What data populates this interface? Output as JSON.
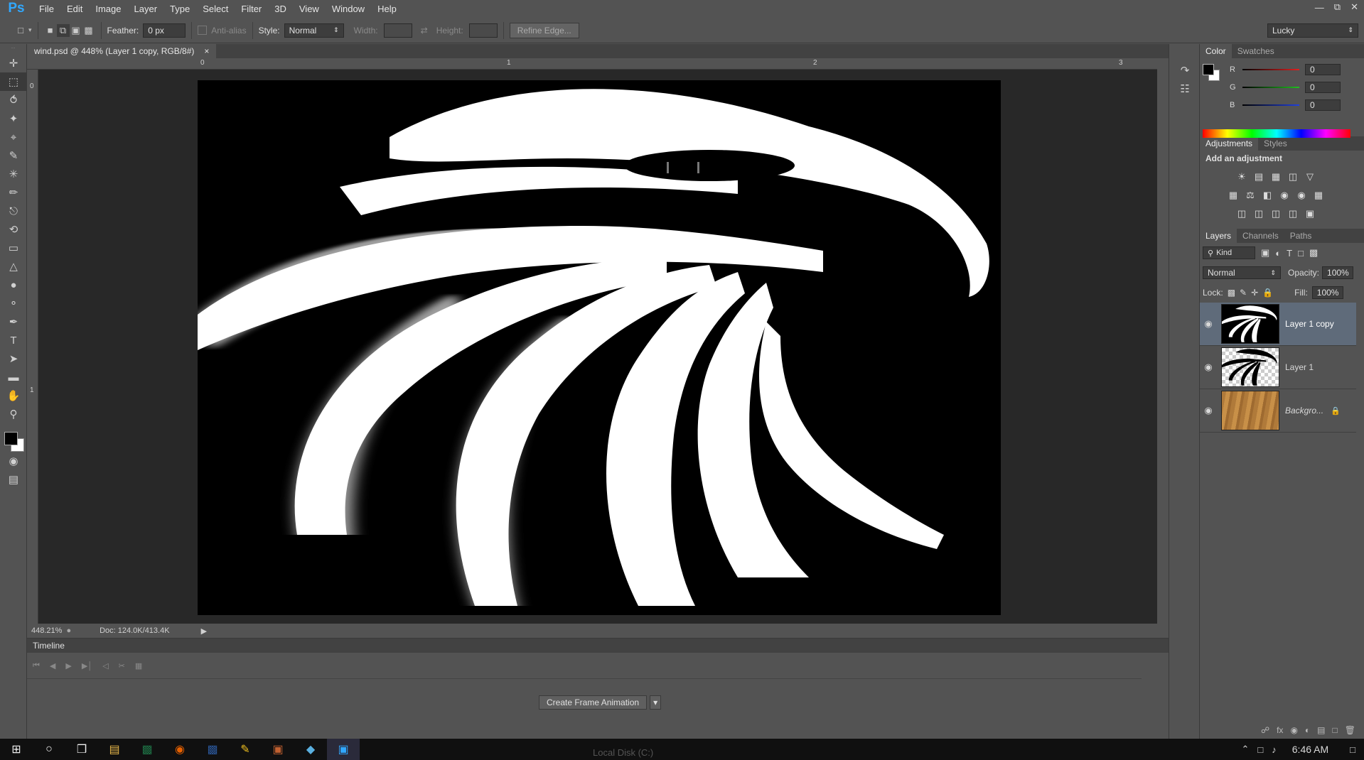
{
  "app": {
    "logo": "Ps"
  },
  "menu": [
    "File",
    "Edit",
    "Image",
    "Layer",
    "Type",
    "Select",
    "Filter",
    "3D",
    "View",
    "Window",
    "Help"
  ],
  "options": {
    "feather_label": "Feather:",
    "feather_value": "0 px",
    "antialias_label": "Anti-alias",
    "style_label": "Style:",
    "style_value": "Normal",
    "width_label": "Width:",
    "height_label": "Height:",
    "refine_edge": "Refine Edge...",
    "workspace": "Lucky"
  },
  "document": {
    "tab_title": "wind.psd @ 448% (Layer 1 copy, RGB/8#)",
    "close": "×",
    "ruler_h": [
      "0",
      "1",
      "2",
      "3"
    ],
    "ruler_v": [
      "0",
      "1"
    ]
  },
  "status": {
    "zoom": "448.21%",
    "doc": "Doc: 124.0K/413.4K"
  },
  "timeline": {
    "title": "Timeline",
    "create_button": "Create Frame Animation"
  },
  "color_panel": {
    "tabs": [
      "Color",
      "Swatches"
    ],
    "channels": [
      {
        "label": "R",
        "value": "0",
        "color": "#e02020"
      },
      {
        "label": "G",
        "value": "0",
        "color": "#20c020"
      },
      {
        "label": "B",
        "value": "0",
        "color": "#2040e0"
      }
    ]
  },
  "adjustments_panel": {
    "tabs": [
      "Adjustments",
      "Styles"
    ],
    "heading": "Add an adjustment"
  },
  "layers_panel": {
    "tabs": [
      "Layers",
      "Channels",
      "Paths"
    ],
    "kind_label": "Kind",
    "blend_mode": "Normal",
    "opacity_label": "Opacity:",
    "opacity_value": "100%",
    "lock_label": "Lock:",
    "fill_label": "Fill:",
    "fill_value": "100%",
    "layers": [
      {
        "name": "Layer 1 copy",
        "selected": true
      },
      {
        "name": "Layer 1",
        "selected": false
      },
      {
        "name": "Backgro...",
        "selected": false
      }
    ]
  },
  "taskbar": {
    "clock": "6:46 AM",
    "behind_text": "Local Disk (C:)"
  }
}
